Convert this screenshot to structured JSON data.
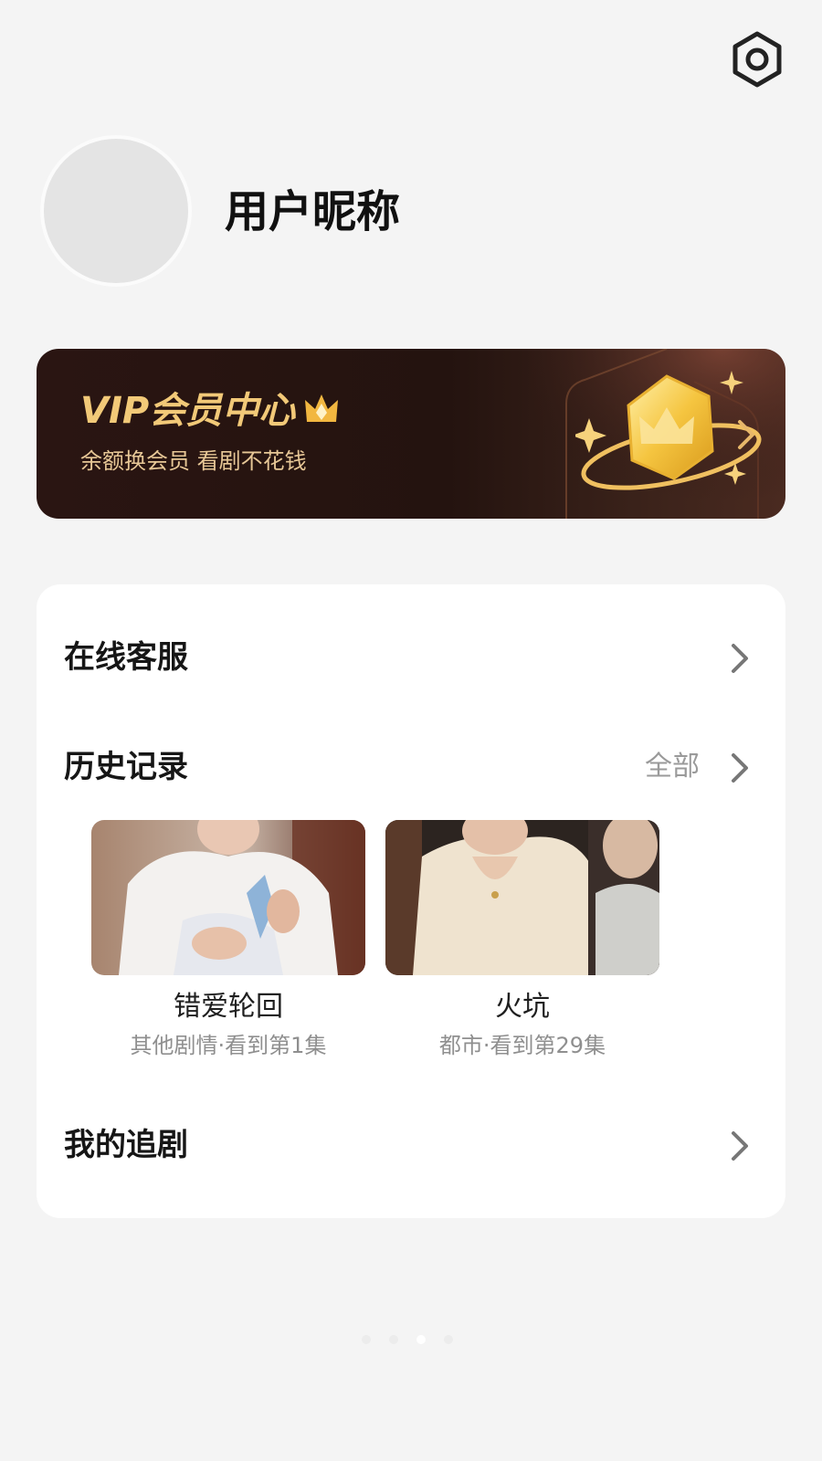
{
  "header": {
    "settings_icon": "hexagon-settings-icon"
  },
  "profile": {
    "nickname": "用户昵称",
    "avatar_color": "#e4e4e4"
  },
  "vip": {
    "title": "VIP会员中心",
    "subtitle": "余额换会员 看剧不花钱",
    "crown_icon": "crown-icon",
    "badge_icon": "vip-crown-badge-icon",
    "arrow_icon": "chevron-right-icon",
    "accent_color": "#f2c978"
  },
  "menu": {
    "customer_service": "在线客服",
    "history": {
      "title": "历史记录",
      "all_label": "全部"
    },
    "my_follows": "我的追剧"
  },
  "history_items": [
    {
      "title": "错爱轮回",
      "meta": "其他剧情·看到第1集"
    },
    {
      "title": "火坑",
      "meta": "都市·看到第29集"
    }
  ],
  "pager": {
    "count": 4,
    "active_index": 2
  }
}
